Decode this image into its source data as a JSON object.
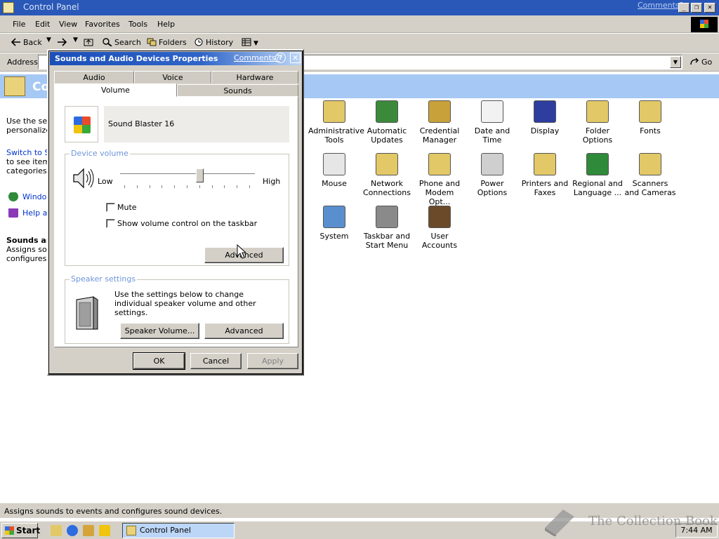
{
  "window": {
    "title": "Control Panel",
    "comments_link": "Comments?",
    "min_glyph": "_",
    "restore_glyph": "❐",
    "close_glyph": "✕"
  },
  "menu": [
    "File",
    "Edit",
    "View",
    "Favorites",
    "Tools",
    "Help"
  ],
  "toolbar": {
    "back": "Back",
    "search": "Search",
    "folders": "Folders",
    "history": "History"
  },
  "address": {
    "label": "Address",
    "value": "",
    "go": "Go"
  },
  "banner": {
    "title": "Co"
  },
  "sidepane": {
    "intro": [
      "Use the set",
      "personalize"
    ],
    "switch_text": [
      "Switch to Si",
      "to see items",
      "categories."
    ],
    "links": [
      "Window",
      "Help an"
    ],
    "details_title": "Sounds an",
    "details_text": [
      "Assigns sou",
      "configures s"
    ]
  },
  "icons": [
    {
      "label": "Administrative Tools",
      "icon": "admin-tools-icon",
      "color": "#e2c866"
    },
    {
      "label": "Automatic Updates",
      "icon": "globe-updates-icon",
      "color": "#3b8a3b"
    },
    {
      "label": "Credential Manager",
      "icon": "keys-icon",
      "color": "#c9a13b"
    },
    {
      "label": "Date and Time",
      "icon": "clock-calendar-icon",
      "color": "#f2f2f2"
    },
    {
      "label": "Display",
      "icon": "monitor-icon",
      "color": "#2d3e9e"
    },
    {
      "label": "Folder Options",
      "icon": "folder-options-icon",
      "color": "#e2c866"
    },
    {
      "label": "Fonts",
      "icon": "fonts-folder-icon",
      "color": "#e2c866"
    },
    {
      "label": "Mouse",
      "icon": "mouse-icon",
      "color": "#e6e6e6"
    },
    {
      "label": "Network Connections",
      "icon": "network-icon",
      "color": "#e2c866"
    },
    {
      "label": "Phone and Modem Opt...",
      "icon": "phone-icon",
      "color": "#e2c866"
    },
    {
      "label": "Power Options",
      "icon": "power-icon",
      "color": "#cfcfcf"
    },
    {
      "label": "Printers and Faxes",
      "icon": "printer-icon",
      "color": "#e2c866"
    },
    {
      "label": "Regional and Language ...",
      "icon": "globe-icon",
      "color": "#2f8a3a"
    },
    {
      "label": "Scanners and Cameras",
      "icon": "scanner-icon",
      "color": "#e2c866"
    },
    {
      "label": "System",
      "icon": "computer-icon",
      "color": "#5a8fcf"
    },
    {
      "label": "Taskbar and Start Menu",
      "icon": "taskbar-icon",
      "color": "#8a8a8a"
    },
    {
      "label": "User Accounts",
      "icon": "users-icon",
      "color": "#6b4a2a"
    }
  ],
  "statusbar": {
    "text": "Assigns sounds to events and configures sound devices."
  },
  "taskbar": {
    "start": "Start",
    "task": "Control Panel",
    "clock": "7:44 AM"
  },
  "watermark": {
    "text": "The Collection Book"
  },
  "dialog": {
    "title": "Sounds and Audio Devices Properties",
    "comments": "Comments?",
    "help_glyph": "?",
    "close_glyph": "✕",
    "tabs_back": [
      "Audio",
      "Voice",
      "Hardware"
    ],
    "tabs_front": [
      "Volume",
      "Sounds"
    ],
    "active_tab": "Volume",
    "device_name": "Sound Blaster 16",
    "device_volume": {
      "label": "Device volume",
      "low": "Low",
      "high": "High",
      "level": 0.6
    },
    "mute_label": "Mute",
    "mute_checked": false,
    "taskbar_vol_label": "Show volume control on the taskbar",
    "taskbar_vol_checked": false,
    "advanced_label": "Advanced",
    "speaker": {
      "label": "Speaker settings",
      "text": "Use the settings below to change individual speaker volume and other settings.",
      "volume_button": "Speaker Volume...",
      "advanced_button": "Advanced"
    },
    "buttons": {
      "ok": "OK",
      "cancel": "Cancel",
      "apply": "Apply"
    }
  },
  "colors": {
    "accent": "#2a58b8",
    "banner": "#a6c8f4",
    "group_label": "#6f95d8"
  }
}
